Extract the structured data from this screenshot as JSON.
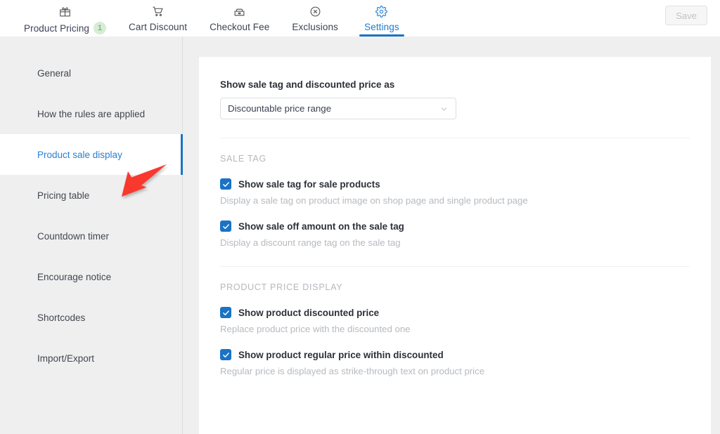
{
  "topbar": {
    "tabs": [
      {
        "label": "Product Pricing",
        "icon": "gift-icon",
        "badge": "1",
        "active": false
      },
      {
        "label": "Cart Discount",
        "icon": "shopping-cart-icon",
        "badge": null,
        "active": false
      },
      {
        "label": "Checkout Fee",
        "icon": "checkout-counter-icon",
        "badge": null,
        "active": false
      },
      {
        "label": "Exclusions",
        "icon": "circle-x-icon",
        "badge": null,
        "active": false
      },
      {
        "label": "Settings",
        "icon": "gear-icon",
        "badge": null,
        "active": true
      }
    ],
    "save_label": "Save",
    "badge_bg": "#d6ecd6",
    "badge_color": "#5aa55a",
    "accent_color": "#1a73c4"
  },
  "ghost_text": "Settings",
  "sidebar": {
    "items": [
      {
        "label": "General",
        "active": false
      },
      {
        "label": "How the rules are applied",
        "active": false
      },
      {
        "label": "Product sale display",
        "active": true
      },
      {
        "label": "Pricing table",
        "active": false
      },
      {
        "label": "Countdown timer",
        "active": false
      },
      {
        "label": "Encourage notice",
        "active": false
      },
      {
        "label": "Shortcodes",
        "active": false
      },
      {
        "label": "Import/Export",
        "active": false
      }
    ],
    "active_color": "#2a7fd0",
    "indicator_color": "#1a73c4"
  },
  "annotation": {
    "arrow_color": "#f9392e",
    "points_to": "Product sale display"
  },
  "main": {
    "display_mode": {
      "label": "Show sale tag and discounted price as",
      "value": "Discountable price range"
    },
    "sections": [
      {
        "title": "SALE TAG",
        "options": [
          {
            "label": "Show sale tag for sale products",
            "help": "Display a sale tag on product image on shop page and single product page",
            "checked": true
          },
          {
            "label": "Show sale off amount on the sale tag",
            "help": "Display a discount range tag on the sale tag",
            "checked": true
          }
        ]
      },
      {
        "title": "PRODUCT PRICE DISPLAY",
        "options": [
          {
            "label": "Show product discounted price",
            "help": "Replace product price with the discounted one",
            "checked": true
          },
          {
            "label": "Show product regular price within discounted",
            "help": "Regular price is displayed as strike-through text on product price",
            "checked": true
          }
        ]
      }
    ]
  }
}
